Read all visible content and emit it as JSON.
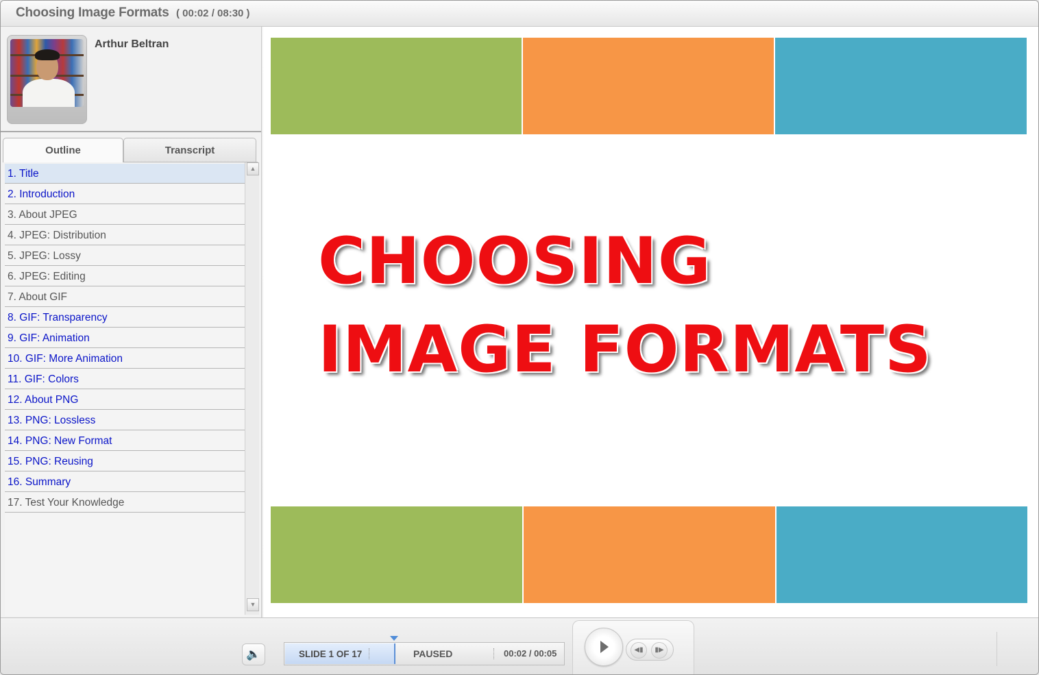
{
  "window": {
    "title": "Choosing Image Formats",
    "time": "( 00:02 / 08:30 )"
  },
  "presenter": {
    "name": "Arthur Beltran"
  },
  "tabs": {
    "outline": "Outline",
    "transcript": "Transcript",
    "active": "Outline"
  },
  "outline": {
    "current_index": 0,
    "items": [
      {
        "label": "1. Title",
        "visited": true
      },
      {
        "label": "2. Introduction",
        "visited": true
      },
      {
        "label": "3. About JPEG",
        "visited": false
      },
      {
        "label": "4. JPEG: Distribution",
        "visited": false
      },
      {
        "label": "5. JPEG: Lossy",
        "visited": false
      },
      {
        "label": "6. JPEG: Editing",
        "visited": false
      },
      {
        "label": "7. About GIF",
        "visited": false
      },
      {
        "label": "8. GIF: Transparency",
        "visited": true
      },
      {
        "label": "9. GIF: Animation",
        "visited": true
      },
      {
        "label": "10.  GIF: More Animation",
        "visited": true
      },
      {
        "label": "11.  GIF: Colors",
        "visited": true
      },
      {
        "label": "12.  About PNG",
        "visited": true
      },
      {
        "label": "13.  PNG: Lossless",
        "visited": true
      },
      {
        "label": "14.  PNG: New Format",
        "visited": true
      },
      {
        "label": "15.  PNG: Reusing",
        "visited": true
      },
      {
        "label": "16.  Summary",
        "visited": true
      },
      {
        "label": "17.  Test Your Knowledge",
        "visited": false
      }
    ]
  },
  "slide": {
    "heading_line1": "CHOOSING",
    "heading_line2": "IMAGE FORMATS",
    "colors": {
      "green": "#9dbb5a",
      "orange": "#f79646",
      "blue": "#4aacc6",
      "heading": "#ee0e12"
    }
  },
  "player": {
    "slide_position": "SLIDE 1 OF 17",
    "status": "PAUSED",
    "slide_time": "00:02 / 00:05",
    "icons": {
      "volume": "volume-icon",
      "play": "play-icon",
      "prev": "previous-icon",
      "next": "next-icon"
    },
    "accent": "#5b8fd6"
  }
}
